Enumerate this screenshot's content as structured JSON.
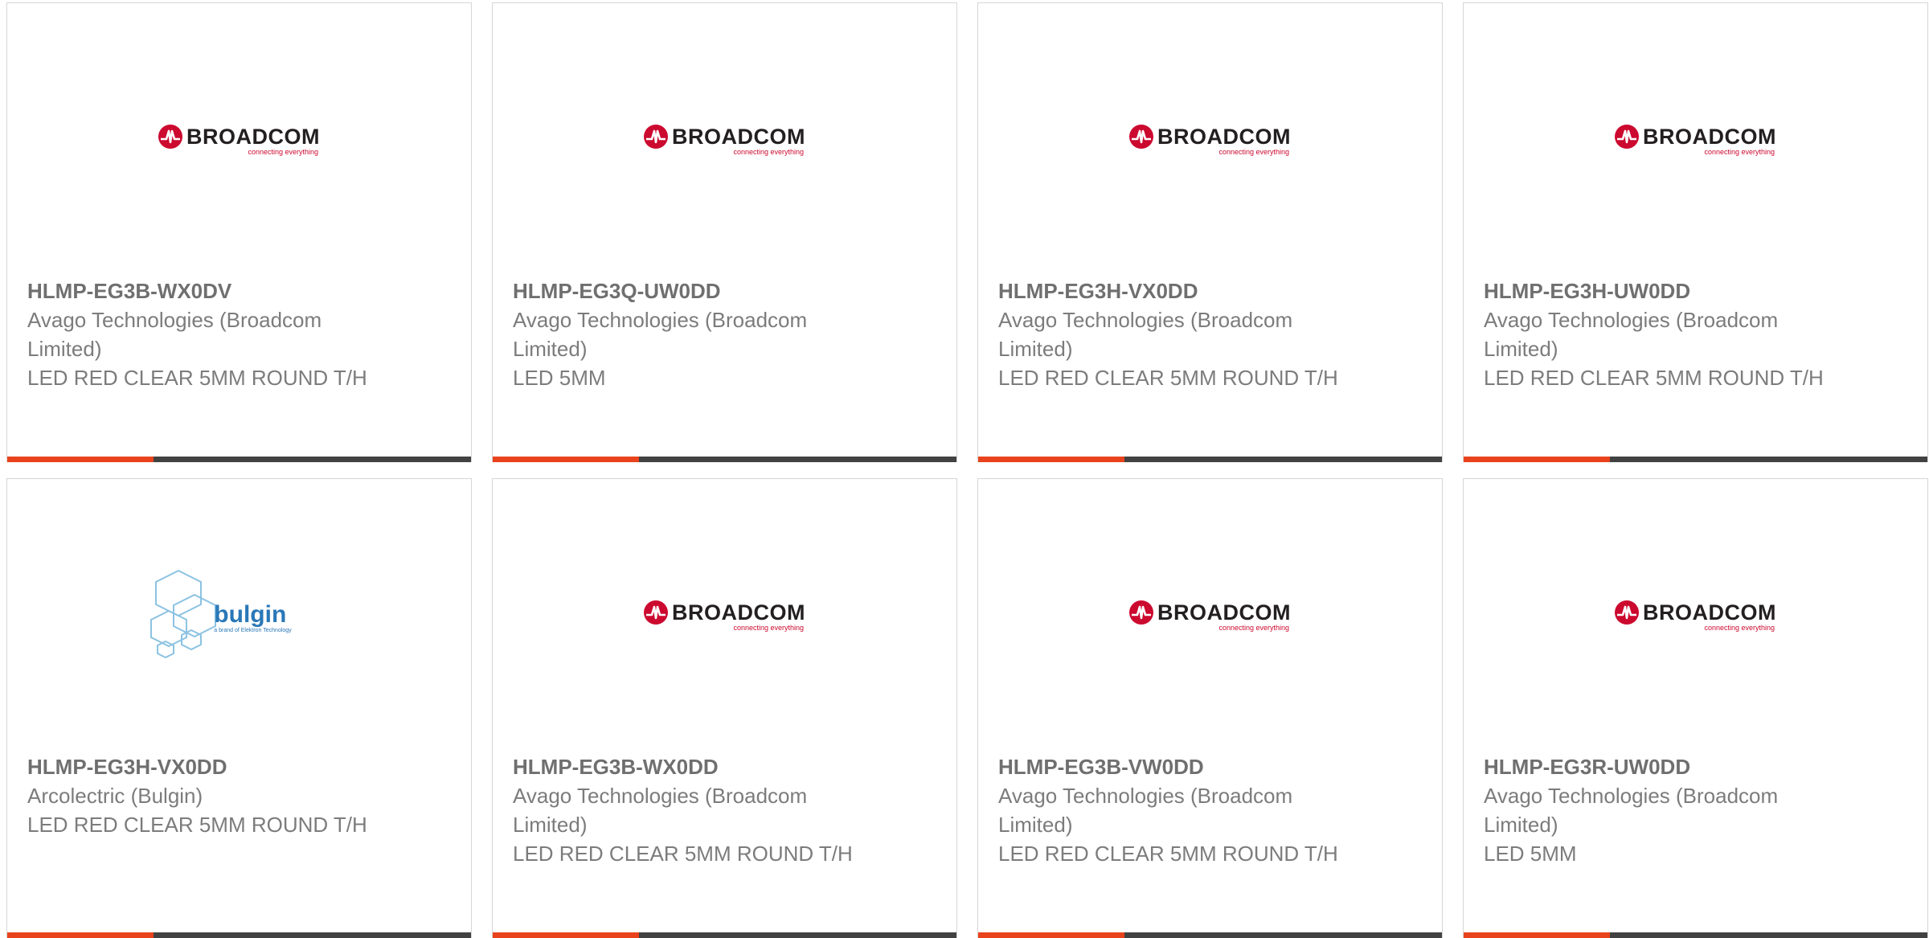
{
  "products": [
    {
      "part_number": "HLMP-EG3B-WX0DV",
      "manufacturer": "Avago Technologies (Broadcom Limited)",
      "description": "LED RED CLEAR 5MM ROUND T/H",
      "logo": {
        "brand": "BROADCOM",
        "tagline": "connecting everything"
      }
    },
    {
      "part_number": "HLMP-EG3Q-UW0DD",
      "manufacturer": "Avago Technologies (Broadcom Limited)",
      "description": "LED 5MM",
      "logo": {
        "brand": "BROADCOM",
        "tagline": "connecting everything"
      }
    },
    {
      "part_number": "HLMP-EG3H-VX0DD",
      "manufacturer": "Avago Technologies (Broadcom Limited)",
      "description": "LED RED CLEAR 5MM ROUND T/H",
      "logo": {
        "brand": "BROADCOM",
        "tagline": "connecting everything"
      }
    },
    {
      "part_number": "HLMP-EG3H-UW0DD",
      "manufacturer": "Avago Technologies (Broadcom Limited)",
      "description": "LED RED CLEAR 5MM ROUND T/H",
      "logo": {
        "brand": "BROADCOM",
        "tagline": "connecting everything"
      }
    },
    {
      "part_number": "HLMP-EG3H-VX0DD",
      "manufacturer": "Arcolectric (Bulgin)",
      "description": "LED RED CLEAR 5MM ROUND T/H",
      "logo": {
        "brand": "bulgin",
        "tagline": "a brand of Elektron Technology"
      }
    },
    {
      "part_number": "HLMP-EG3B-WX0DD",
      "manufacturer": "Avago Technologies (Broadcom Limited)",
      "description": "LED RED CLEAR 5MM ROUND T/H",
      "logo": {
        "brand": "BROADCOM",
        "tagline": "connecting everything"
      }
    },
    {
      "part_number": "HLMP-EG3B-VW0DD",
      "manufacturer": "Avago Technologies (Broadcom Limited)",
      "description": "LED RED CLEAR 5MM ROUND T/H",
      "logo": {
        "brand": "BROADCOM",
        "tagline": "connecting everything"
      }
    },
    {
      "part_number": "HLMP-EG3R-UW0DD",
      "manufacturer": "Avago Technologies (Broadcom Limited)",
      "description": "LED 5MM",
      "logo": {
        "brand": "BROADCOM",
        "tagline": "connecting everything"
      }
    }
  ],
  "colors": {
    "accent": "#e8431c",
    "bar": "#424242",
    "broadcom_red": "#cc092f",
    "bulgin_blue": "#2a78b8",
    "text": "#757575"
  }
}
